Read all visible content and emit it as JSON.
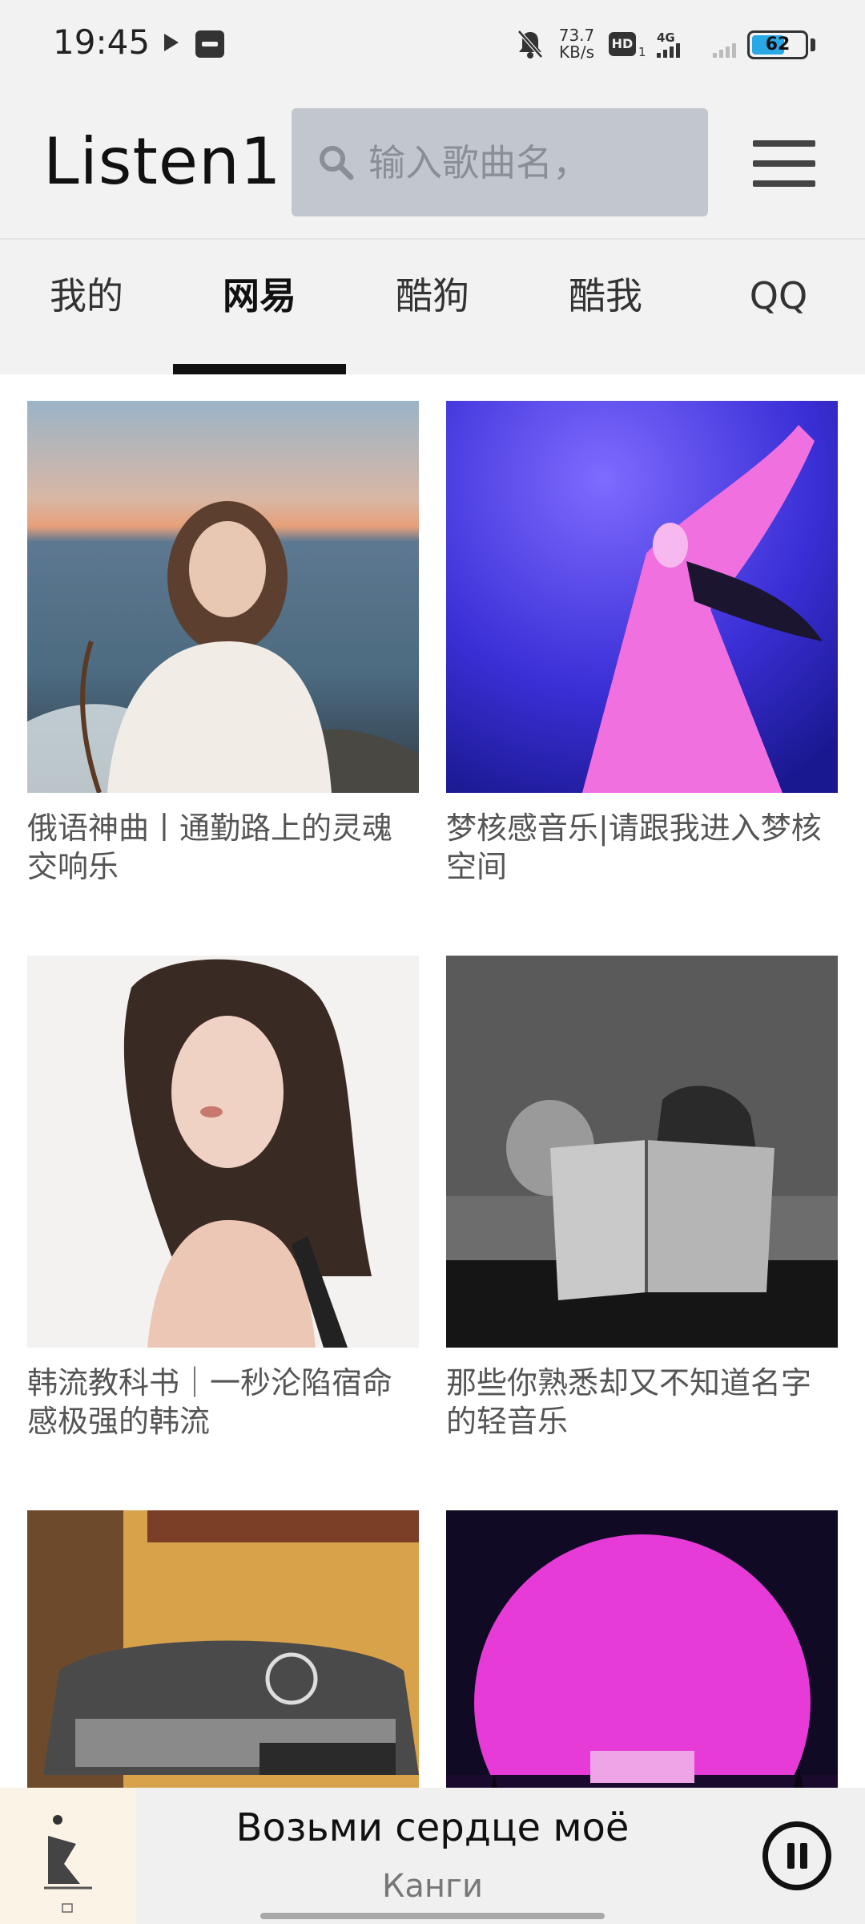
{
  "status_bar": {
    "time": "19:45",
    "net_speed_value": "73.7",
    "net_speed_unit": "KB/s",
    "hd_label": "HD",
    "hd_sub": "1",
    "signal_label": "4G",
    "battery": "62",
    "battery_level": 0.62,
    "battery_color": "#29a8e6"
  },
  "header": {
    "app_title": "Listen1",
    "search_placeholder": "输入歌曲名，",
    "menu_icon": "hamburger-icon",
    "search_icon": "search-icon"
  },
  "tabs": [
    {
      "label": "我的",
      "active": false
    },
    {
      "label": "网易",
      "active": true
    },
    {
      "label": "酷狗",
      "active": false
    },
    {
      "label": "酷我",
      "active": false
    },
    {
      "label": "QQ",
      "active": false
    }
  ],
  "playlists": [
    {
      "title": "俄语神曲丨通勤路上的灵魂交响乐"
    },
    {
      "title": "梦核感音乐|请跟我进入梦核空间"
    },
    {
      "title": "韩流教科书｜一秒沦陷宿命感极强的韩流"
    },
    {
      "title": "那些你熟悉却又不知道名字的轻音乐"
    },
    {
      "title": ""
    },
    {
      "title": ""
    }
  ],
  "player": {
    "title": "Возьми сердце моё",
    "artist": "Канги",
    "pause_icon": "pause-icon"
  },
  "colors": {
    "bar_background": "#f2f2f2",
    "search_background": "#c2c7cf",
    "tab_indicator": "#111111"
  }
}
